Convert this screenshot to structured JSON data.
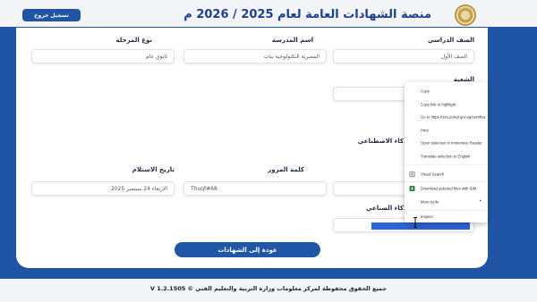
{
  "header": {
    "title": "منصة الشهادات العامة لعام 2025 / 2026 م",
    "logout_label": "تسجيل خروج",
    "logo_icon": "ministry-emblem-icon"
  },
  "form": {
    "grade": {
      "label": "الصف الدراسي",
      "value": "الصف الأول"
    },
    "school": {
      "label": "اسم المدرسة",
      "value": "المصرية التكنولوجية بنات"
    },
    "stage_type": {
      "label": "نوع المرحلة",
      "value": "ثانوي عام"
    },
    "division": {
      "label": "الشعبة",
      "value": ""
    },
    "ai_subject": {
      "label": "الذكاء الاصطناعي"
    },
    "receipt_date": {
      "label": "تاريخ الاستلام",
      "value": "الاربعاء 24 سبتمبر 2025"
    },
    "password": {
      "label": "كلمة المرور",
      "value": "Thuqf#68"
    },
    "ai_field": {
      "label": "الذكاء الصناعي"
    }
  },
  "back_button": "عودة إلى الشهادات",
  "footer": "جميع الحقوق محفوظة لمركز معلومات وزارة التربية والتعليم الفني © V 1.2.1505",
  "context_menu": {
    "items": [
      {
        "label": "Copy"
      },
      {
        "label": "Copy link to highlight"
      },
      {
        "label": "Go to https://ses.portal.gov.eg/certificates"
      },
      {
        "label": "Print"
      },
      {
        "label": "Open selection in Immersive Reader"
      },
      {
        "label": "Translate selection to English"
      },
      {
        "label": "Visual Search",
        "icon": "visual-search-icon"
      },
      {
        "label": "Download selected files with IDM",
        "icon": "idm-download-icon"
      },
      {
        "label": "More tools",
        "icon": "chevron-right-icon"
      },
      {
        "label": "Inspect"
      }
    ]
  },
  "colors": {
    "primary": "#1f55a4",
    "title": "#1d3f8f",
    "selection": "#2b63d9"
  }
}
